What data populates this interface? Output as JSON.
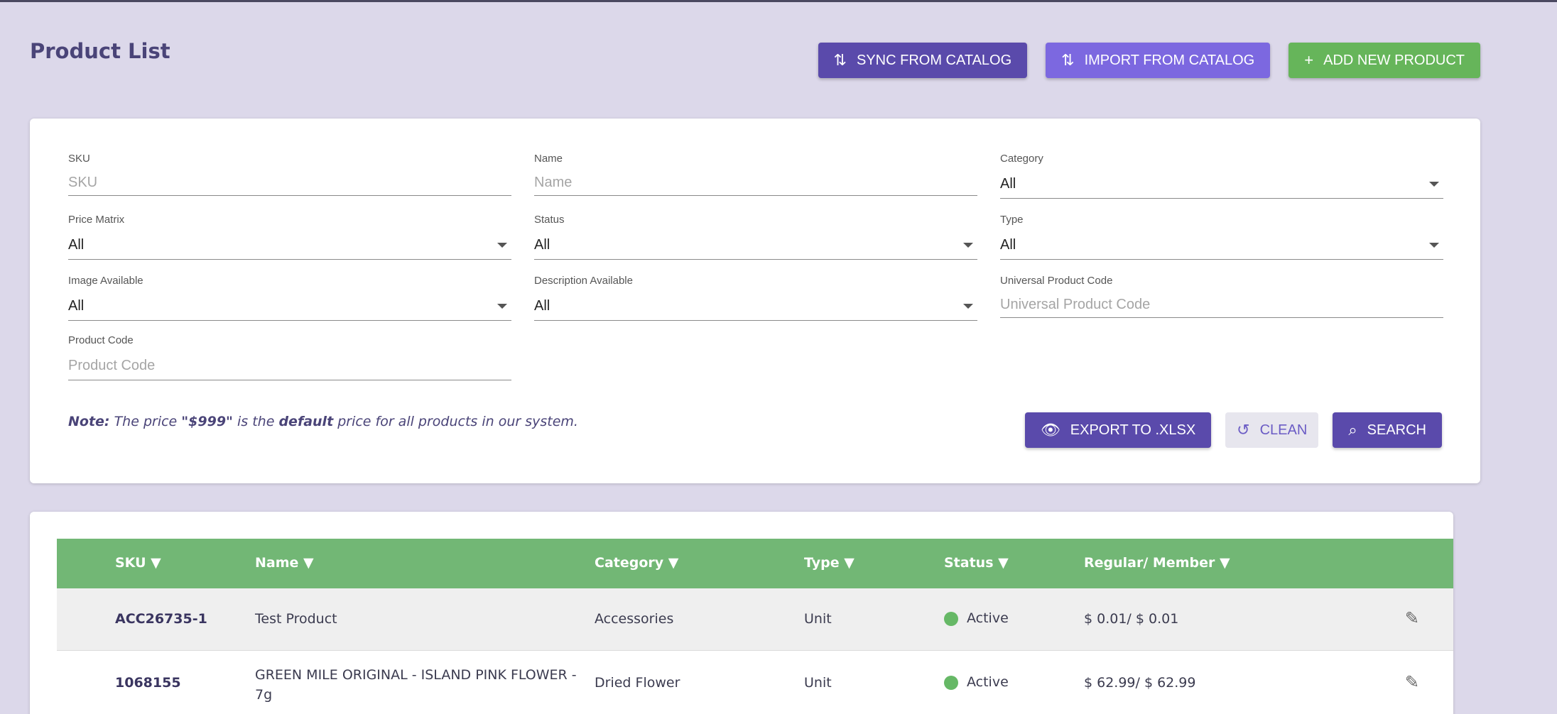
{
  "header": {
    "title": "Product List",
    "actions": {
      "sync_label": "SYNC FROM CATALOG",
      "import_label": "IMPORT FROM CATALOG",
      "add_label": "ADD NEW PRODUCT"
    }
  },
  "filters": {
    "sku": {
      "label": "SKU",
      "placeholder": "SKU"
    },
    "name": {
      "label": "Name",
      "placeholder": "Name"
    },
    "category": {
      "label": "Category",
      "value": "All"
    },
    "price_matrix": {
      "label": "Price Matrix",
      "value": "All"
    },
    "status": {
      "label": "Status",
      "value": "All"
    },
    "type": {
      "label": "Type",
      "value": "All"
    },
    "image_available": {
      "label": "Image Available",
      "value": "All"
    },
    "description_available": {
      "label": "Description Available",
      "value": "All"
    },
    "upc": {
      "label": "Universal Product Code",
      "placeholder": "Universal Product Code"
    },
    "product_code": {
      "label": "Product Code",
      "placeholder": "Product Code"
    }
  },
  "note": {
    "prefix": "Note:",
    "text1": " The price ",
    "price": "\"$999\"",
    "text2": " is the ",
    "bold": "default",
    "text3": " price for all products in our system."
  },
  "filter_actions": {
    "export_label": "EXPORT TO .XLSX",
    "clean_label": "CLEAN",
    "search_label": "SEARCH"
  },
  "table": {
    "columns": {
      "sku": "SKU ▼",
      "name": "Name ▼",
      "category": "Category ▼",
      "type": "Type ▼",
      "status": "Status ▼",
      "price": "Regular/ Member ▼"
    },
    "rows": [
      {
        "sku": "ACC26735-1",
        "name": "Test Product",
        "category": "Accessories",
        "type": "Unit",
        "status": "Active",
        "price": "$ 0.01/ $ 0.01"
      },
      {
        "sku": "1068155",
        "name_line1": "GREEN MILE ORIGINAL - ISLAND PINK FLOWER -",
        "name_line2": "7g",
        "category": "Dried Flower",
        "type": "Unit",
        "status": "Active",
        "price": "$ 62.99/ $ 62.99"
      }
    ]
  },
  "colors": {
    "background": "#dcd8ea",
    "primary": "#5a4aab",
    "primary_light": "#7c68e0",
    "success": "#66b55a",
    "table_header": "#72b775",
    "status_active": "#66b866"
  },
  "icons": {
    "sync": "swap-vertical-icon",
    "import": "swap-vertical-icon",
    "add": "plus-icon",
    "export": "eye-icon",
    "clean": "history-icon",
    "search": "search-icon",
    "edit": "pencil-icon"
  }
}
